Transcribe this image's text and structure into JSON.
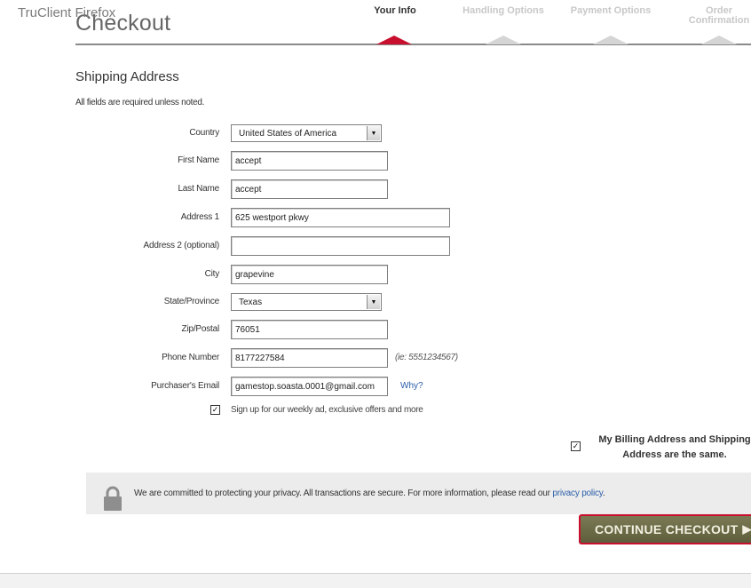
{
  "browser": {
    "title": "TruClient Firefox"
  },
  "page": {
    "title": "Checkout"
  },
  "steps": [
    {
      "label": "Your Info",
      "active": true
    },
    {
      "label": "Handling Options",
      "active": false
    },
    {
      "label": "Payment Options",
      "active": false
    },
    {
      "label": "Order Confirmation",
      "active": false
    }
  ],
  "form": {
    "section_title": "Shipping Address",
    "required_note": "All fields are required unless noted.",
    "country": {
      "label": "Country",
      "value": "United States of America"
    },
    "first_name": {
      "label": "First Name",
      "value": "accept"
    },
    "last_name": {
      "label": "Last Name",
      "value": "accept"
    },
    "address1": {
      "label": "Address 1",
      "value": "625 westport pkwy"
    },
    "address2": {
      "label": "Address 2 (optional)",
      "value": ""
    },
    "city": {
      "label": "City",
      "value": "grapevine"
    },
    "state": {
      "label": "State/Province",
      "value": "Texas"
    },
    "zip": {
      "label": "Zip/Postal",
      "value": "76051"
    },
    "phone": {
      "label": "Phone Number",
      "value": "8177227584",
      "hint": "(ie: 5551234567)"
    },
    "email": {
      "label": "Purchaser's Email",
      "value": "gamestop.soasta.0001@gmail.com",
      "why": "Why?"
    },
    "signup": {
      "label": "Sign up for our weekly ad, exclusive offers and more",
      "checked": true
    },
    "billing_same": {
      "line1": "My Billing Address and Shipping",
      "line2": "Address are the same.",
      "checked": true
    }
  },
  "privacy": {
    "text": "We are committed to protecting your privacy. All transactions are secure. For more information, please read our ",
    "link": "privacy policy",
    "end": "."
  },
  "checkout_button": {
    "label": "CONTINUE CHECKOUT"
  },
  "colors": {
    "accent": "#c8102e",
    "button": "#6b6a47",
    "link": "#2a5da8"
  }
}
